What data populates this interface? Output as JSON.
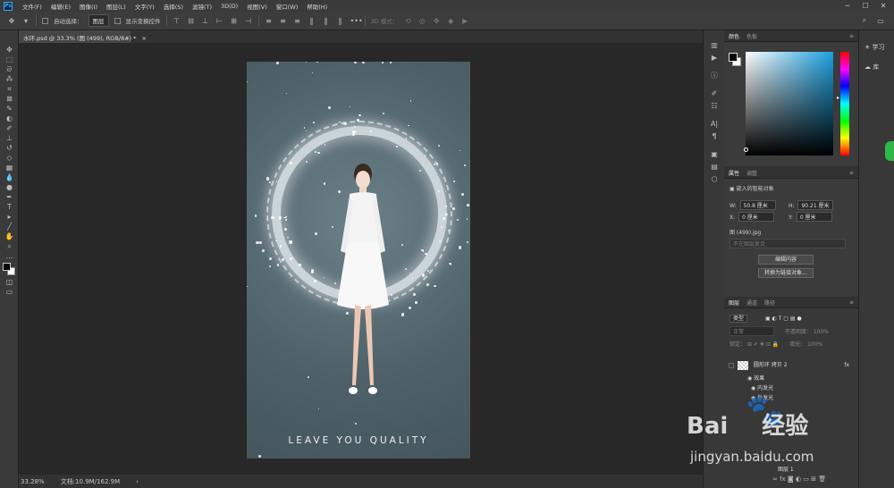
{
  "app": {
    "logo": "Ps"
  },
  "menubar": {
    "items": [
      "文件(F)",
      "编辑(E)",
      "图像(I)",
      "图层(L)",
      "文字(Y)",
      "选择(S)",
      "滤镜(T)",
      "3D(D)",
      "视图(V)",
      "窗口(W)",
      "帮助(H)"
    ]
  },
  "window_controls": {
    "minimize": "─",
    "maximize": "☐",
    "close": "✕"
  },
  "options": {
    "auto_select_label": "自动选择：",
    "auto_select_value": "图层",
    "show_transform_label": "显示变换控件",
    "mode_3d_label": "3D 模式："
  },
  "document": {
    "tab_title": "水环.psd @ 33.3% (图 (499), RGB/8#) *",
    "tab_close": "×",
    "tagline": "LEAVE YOU QUALITY"
  },
  "status": {
    "zoom": "33.28%",
    "doc_size": "文档:10.9M/162.9M"
  },
  "color_panel": {
    "tabs": [
      "颜色",
      "色板"
    ]
  },
  "properties_panel": {
    "tabs": [
      "属性",
      "调整"
    ],
    "type_label": "嵌入的智能对象",
    "w_label": "W:",
    "w_value": "50.8 厘米",
    "h_label": "H:",
    "h_value": "90.21 厘米",
    "x_label": "X:",
    "x_value": "0 厘米",
    "y_label": "Y:",
    "y_value": "0 厘米",
    "source_name": "图 (499).jpg",
    "comp_placeholder": "不在图层复合",
    "edit_button": "编辑内容",
    "convert_button": "转换为链接对象..."
  },
  "layers_panel": {
    "tabs": [
      "图层",
      "通道",
      "路径"
    ],
    "filter_value": "类型",
    "blend_mode": "正常",
    "opacity_label": "不透明度：",
    "opacity_value": "100%",
    "lock_label": "锁定：",
    "fill_label": "填充：",
    "fill_value": "100%",
    "layers": [
      {
        "name": "圆形环 拷贝 2",
        "fx": "fx"
      },
      {
        "name": "效果"
      },
      {
        "name": "内发光"
      },
      {
        "name": "外发光"
      }
    ],
    "bottom_layer_name": "图层 1"
  },
  "learn_panel": {
    "items": [
      "学习",
      "库"
    ]
  },
  "watermark": {
    "brand": "Bai",
    "brand_suffix": "经验",
    "url": "jingyan.baidu.com"
  }
}
